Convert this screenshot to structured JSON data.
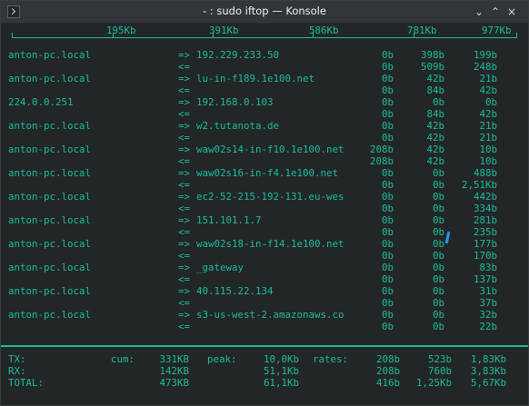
{
  "window": {
    "title": "- : sudo iftop — Konsole",
    "controls": {
      "minimize": "⌄",
      "maximize": "⌃",
      "close": "×"
    }
  },
  "scale": {
    "labels": [
      "195Kb",
      "391Kb",
      "586Kb",
      "781Kb",
      "977Kb"
    ]
  },
  "flows": [
    {
      "source": "anton-pc.local",
      "destination": "192.229.233.50",
      "out": [
        "0b",
        "398b",
        "199b"
      ],
      "in": [
        "0b",
        "509b",
        "248b"
      ]
    },
    {
      "source": "anton-pc.local",
      "destination": "lu-in-f189.1e100.net",
      "out": [
        "0b",
        "42b",
        "21b"
      ],
      "in": [
        "0b",
        "84b",
        "42b"
      ]
    },
    {
      "source": "224.0.0.251",
      "destination": "192.168.0.103",
      "out": [
        "0b",
        "0b",
        "0b"
      ],
      "in": [
        "0b",
        "84b",
        "42b"
      ]
    },
    {
      "source": "anton-pc.local",
      "destination": "w2.tutanota.de",
      "out": [
        "0b",
        "42b",
        "21b"
      ],
      "in": [
        "0b",
        "42b",
        "21b"
      ]
    },
    {
      "source": "anton-pc.local",
      "destination": "waw02s14-in-f10.1e100.net",
      "out": [
        "208b",
        "42b",
        "10b"
      ],
      "in": [
        "208b",
        "42b",
        "10b"
      ]
    },
    {
      "source": "anton-pc.local",
      "destination": "waw02s16-in-f4.1e100.net",
      "out": [
        "0b",
        "0b",
        "488b"
      ],
      "in": [
        "0b",
        "0b",
        "2,51Kb"
      ]
    },
    {
      "source": "anton-pc.local",
      "destination": "ec2-52-215-192-131.eu-wes",
      "out": [
        "0b",
        "0b",
        "442b"
      ],
      "in": [
        "0b",
        "0b",
        "334b"
      ]
    },
    {
      "source": "anton-pc.local",
      "destination": "151.101.1.7",
      "out": [
        "0b",
        "0b",
        "281b"
      ],
      "in": [
        "0b",
        "0b",
        "235b"
      ]
    },
    {
      "source": "anton-pc.local",
      "destination": "waw02s18-in-f14.1e100.net",
      "out": [
        "0b",
        "0b",
        "177b"
      ],
      "in": [
        "0b",
        "0b",
        "170b"
      ]
    },
    {
      "source": "anton-pc.local",
      "destination": "_gateway",
      "out": [
        "0b",
        "0b",
        "83b"
      ],
      "in": [
        "0b",
        "0b",
        "137b"
      ]
    },
    {
      "source": "anton-pc.local",
      "destination": "40.115.22.134",
      "out": [
        "0b",
        "0b",
        "31b"
      ],
      "in": [
        "0b",
        "0b",
        "37b"
      ]
    },
    {
      "source": "anton-pc.local",
      "destination": "s3-us-west-2.amazonaws.co",
      "out": [
        "0b",
        "0b",
        "32b"
      ],
      "in": [
        "0b",
        "0b",
        "22b"
      ]
    }
  ],
  "arrows": {
    "out": "=>",
    "in": "<="
  },
  "summary": {
    "labels": {
      "cum": "cum:",
      "peak": "peak:",
      "rates": "rates:"
    },
    "rows": [
      {
        "label": "TX:",
        "cum": "331KB",
        "peak": "10,0Kb",
        "rates": [
          "208b",
          "523b",
          "1,83Kb"
        ]
      },
      {
        "label": "RX:",
        "cum": "142KB",
        "peak": "51,1Kb",
        "rates": [
          "208b",
          "760b",
          "3,83Kb"
        ]
      },
      {
        "label": "TOTAL:",
        "cum": "473KB",
        "peak": "61,1Kb",
        "rates": [
          "416b",
          "1,25Kb",
          "5,67Kb"
        ]
      }
    ]
  }
}
